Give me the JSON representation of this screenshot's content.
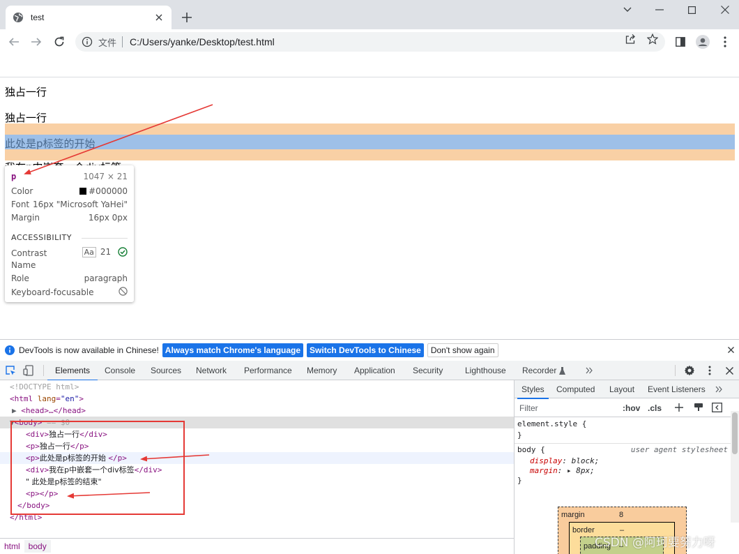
{
  "browser": {
    "tab_title": "test",
    "omnibox_file_label": "文件",
    "url": "C:/Users/yanke/Desktop/test.html"
  },
  "page": {
    "lines": [
      "独占一行",
      "独占一行",
      "此处是p标签的开始",
      "我在p中嵌套一个div标签"
    ]
  },
  "inspector_tooltip": {
    "tag": "p",
    "dimensions": "1047 × 21",
    "color_label": "Color",
    "color_value": "#000000",
    "font_label": "Font",
    "font_value": "16px \"Microsoft YaHei\"",
    "margin_label": "Margin",
    "margin_value": "16px 0px",
    "section_title": "ACCESSIBILITY",
    "contrast_label": "Contrast",
    "contrast_aa": "Aa",
    "contrast_value": "21",
    "name_label": "Name",
    "role_label": "Role",
    "role_value": "paragraph",
    "focus_label": "Keyboard-focusable"
  },
  "infobar": {
    "message": "DevTools is now available in Chinese!",
    "btn_match": "Always match Chrome's language",
    "btn_switch": "Switch DevTools to Chinese",
    "btn_dismiss": "Don't show again"
  },
  "devtools_tabs": [
    "Elements",
    "Console",
    "Sources",
    "Network",
    "Performance",
    "Memory",
    "Application",
    "Security",
    "Lighthouse",
    "Recorder"
  ],
  "elements_tree": {
    "doctype": "<!DOCTYPE html>",
    "html_open": "<html",
    "html_attr": "lang",
    "html_val": "\"en\"",
    "head": "<head>…</head>",
    "body_open": "<body>",
    "body_eq": "== $0",
    "lines": [
      {
        "open": "<div>",
        "text": "独占一行",
        "close": "</div>"
      },
      {
        "open": "<p>",
        "text": "独占一行",
        "close": "</p>"
      },
      {
        "open": "<p>",
        "text": "此处是p标签的开始 ",
        "close": "</p>"
      },
      {
        "open": "<div>",
        "text": "我在p中嵌套一个div标签",
        "close": "</div>"
      },
      {
        "open": "",
        "text": "\" 此处是p标签的结束\"",
        "close": ""
      },
      {
        "open": "<p>",
        "text": "",
        "close": "</p>"
      }
    ],
    "body_close": "</body>",
    "html_close": "</html>"
  },
  "breadcrumb": [
    "html",
    "body"
  ],
  "styles_pane": {
    "tabs": [
      "Styles",
      "Computed",
      "Layout",
      "Event Listeners"
    ],
    "filter_placeholder": "Filter",
    "hov": ":hov",
    "cls": ".cls",
    "element_style": "element.style {",
    "brace_close": "}",
    "body_rule": "body {",
    "ua_label": "user agent stylesheet",
    "prop1_name": "display",
    "prop1_value": "block;",
    "prop2_name": "margin",
    "prop2_value": "8px;",
    "box_margin_label": "margin",
    "box_margin_value": "8",
    "box_border_label": "border",
    "box_border_value": "–",
    "box_padding_label": "padding",
    "box_padding_value": "–"
  },
  "watermark": "CSDN @阿珂要努力呀",
  "colors": {
    "accent_blue": "#1a73e8",
    "highlight_margin": "#f8cb9b",
    "highlight_content": "#9ec0e8",
    "annotation_red": "#e53935",
    "tag_purple": "#881280"
  }
}
